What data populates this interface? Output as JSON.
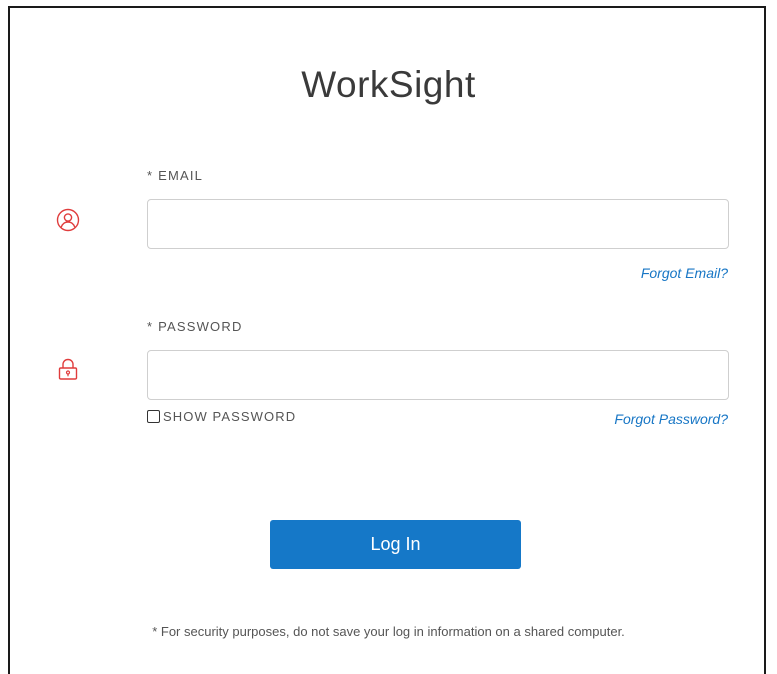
{
  "app": {
    "title": "WorkSight"
  },
  "email": {
    "label": "* EMAIL",
    "value": "",
    "placeholder": "",
    "icon": "user-icon",
    "forgot_link": "Forgot Email?"
  },
  "password": {
    "label": "* PASSWORD",
    "value": "",
    "placeholder": "",
    "icon": "lock-icon",
    "show_label": "SHOW PASSWORD",
    "show_checked": false,
    "forgot_link": "Forgot Password?"
  },
  "login": {
    "button_label": "Log In"
  },
  "footer": {
    "note": "* For security purposes, do not save your log in information on a shared computer."
  },
  "colors": {
    "accent": "#1578c8",
    "link": "#1776c5",
    "icon": "#e03c3c"
  }
}
